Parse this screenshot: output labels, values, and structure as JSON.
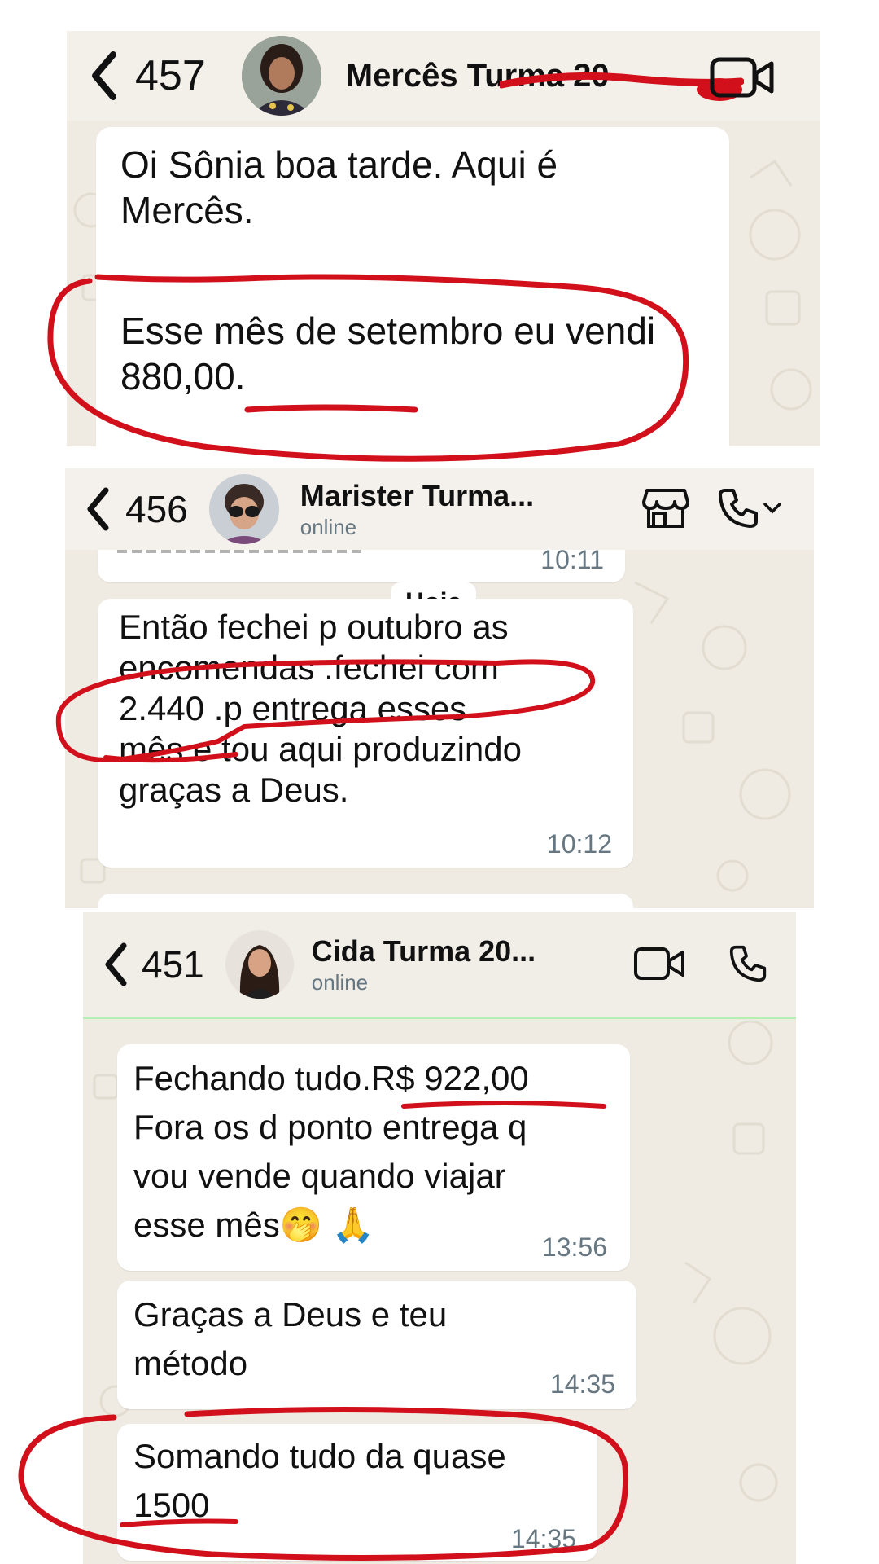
{
  "colors": {
    "wallpaper": "#efeae2",
    "bubble": "#ffffff",
    "annotation": "#d1101b",
    "muted": "#667781"
  },
  "chat1": {
    "count": "457",
    "contact_name": "Mercês Turma 20",
    "messages": [
      {
        "text": "Oi Sônia boa tarde. Aqui é Mercês."
      },
      {
        "text_prefix": "Esse mês de setembro eu vendi ",
        "amount": "880,00",
        "text_suffix": "."
      }
    ],
    "icons": [
      "back-chevron-icon",
      "video-call-icon"
    ]
  },
  "chat2": {
    "count": "456",
    "contact_name": "Marister  Turma...",
    "status": "online",
    "partial_time": "10:11",
    "day_label": "Hoje",
    "message": {
      "line1": "Então fechei p outubro as",
      "line2": "encomendas .fechei com",
      "amount": "2.440",
      "line3_rest": " .p entrega esses",
      "line4": "mês e tou aqui produzindo",
      "line5": "graças a Deus.",
      "time": "10:12"
    },
    "icons": [
      "back-chevron-icon",
      "store-icon",
      "phone-icon",
      "chevron-down-icon"
    ]
  },
  "chat3": {
    "count": "451",
    "contact_name": "Cida Turma 20...",
    "status": "online",
    "messages": [
      {
        "prefix": "Fechando tudo.",
        "amount": "R$ 922,00",
        "line2": "Fora os d ponto entrega  q",
        "line3": "vou vende quando viajar",
        "line4": "esse mês",
        "emojis": "🤭 🙏",
        "time": "13:56"
      },
      {
        "line1": "Graças a Deus e teu",
        "line2": "método",
        "time": "14:35"
      },
      {
        "line1": "Somando tudo da quase",
        "amount": "1500",
        "time": "14:35"
      }
    ],
    "icons": [
      "back-chevron-icon",
      "video-call-icon",
      "phone-icon"
    ]
  }
}
